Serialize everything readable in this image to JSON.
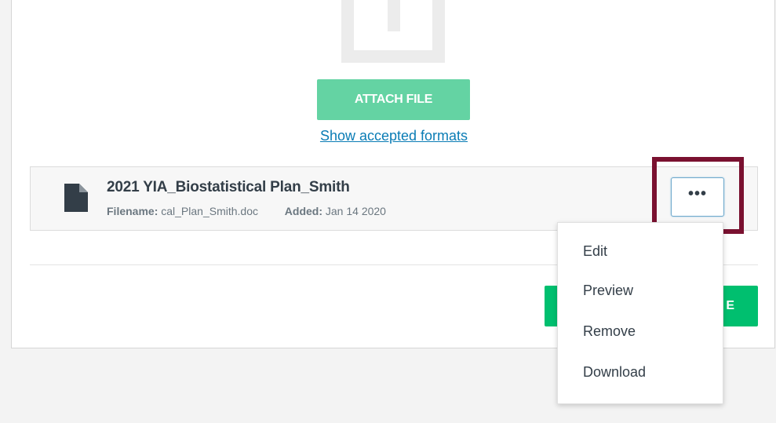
{
  "uploader": {
    "attach_label": "ATTACH FILE",
    "formats_link": "Show accepted formats",
    "icon": "upload-icon"
  },
  "file": {
    "title": "2021 YIA_Biostatistical Plan_Smith",
    "filename_label": "Filename:",
    "filename": "cal_Plan_Smith.doc",
    "added_label": "Added:",
    "added": "Jan 14 2020",
    "icon": "document-icon",
    "more_label": "•••"
  },
  "footer": {
    "save_label": "E"
  },
  "menu": {
    "items": [
      {
        "label": "Edit"
      },
      {
        "label": "Preview"
      },
      {
        "label": "Remove"
      },
      {
        "label": "Download"
      }
    ]
  },
  "colors": {
    "attach_button": "#64d3a3",
    "save_button": "#00bf6f",
    "link": "#0a7cb5",
    "highlight": "#7a1130",
    "text": "#333e48"
  }
}
